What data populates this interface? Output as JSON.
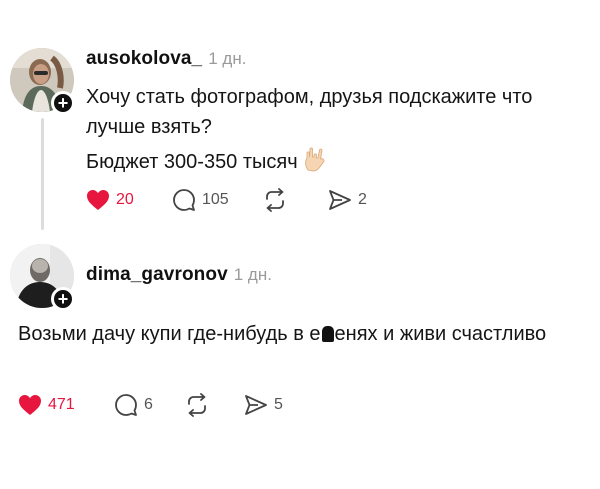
{
  "posts": [
    {
      "username": "ausokolova_",
      "time": "1 дн.",
      "lines": [
        "Хочу стать фотографом, друзья подскажите что лучше взять?",
        "Бюджет 300-350 тысяч"
      ],
      "emoji": "hand-icon",
      "likes": "20",
      "comments": "105",
      "shares": "2",
      "liked": true
    },
    {
      "username": "dima_gavronov",
      "time": "1 дн.",
      "lines": [
        "Возьми дачу купи где-нибудь в е",
        "енях и живи счастливо"
      ],
      "likes": "471",
      "comments": "6",
      "shares": "5",
      "liked": true
    }
  ],
  "colors": {
    "like": "#e6163f",
    "muted": "#9a9a9a",
    "icon": "#555555"
  }
}
